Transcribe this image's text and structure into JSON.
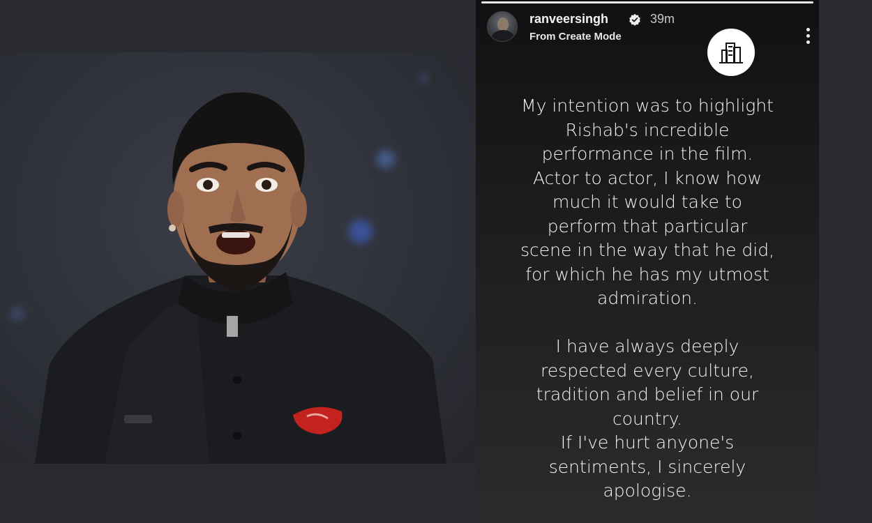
{
  "story": {
    "username": "ranveersingh",
    "timestamp": "39m",
    "subtitle": "From Create Mode",
    "progress": 1.0,
    "paragraphs": [
      [
        "My intention was to highlight",
        "Rishab's incredible",
        "performance in the film.",
        "Actor to actor, I know how",
        "much it would take to",
        "perform that particular",
        "scene in the way that he did,",
        "for which he has my utmost",
        "admiration."
      ],
      [
        "I have always deeply",
        "respected every culture,",
        "tradition and belief in our",
        "country.",
        "If I've hurt anyone's",
        "sentiments, I sincerely",
        "apologise."
      ]
    ]
  },
  "icons": {
    "verified": "verified-badge-icon",
    "more": "more-options-icon",
    "sticker": "building-logo-icon"
  },
  "colors": {
    "background": "#2a2b31",
    "story_background": "#1c1c1e",
    "text": "#f3f3f3",
    "pocket_square": "#c4221f"
  }
}
